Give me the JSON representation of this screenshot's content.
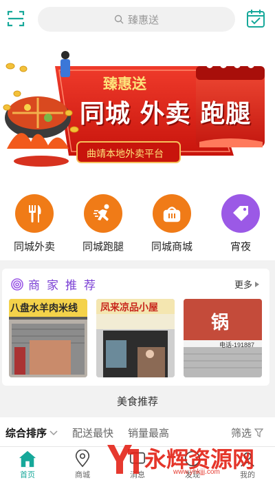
{
  "search": {
    "placeholder": "臻惠送"
  },
  "banner": {
    "brand": "臻惠送",
    "headline": "同城 外卖 跑腿",
    "tagline": "曲靖本地外卖平台"
  },
  "categories": [
    {
      "label": "同城外卖",
      "color": "#f07b17",
      "icon": "fork-knife-icon"
    },
    {
      "label": "同城跑腿",
      "color": "#f07b17",
      "icon": "runner-icon"
    },
    {
      "label": "同城商城",
      "color": "#f07b17",
      "icon": "basket-icon"
    },
    {
      "label": "宵夜",
      "color": "#9b59e6",
      "icon": "tag-icon"
    }
  ],
  "merchants": {
    "title": "商家推荐",
    "more": "更多",
    "shops": [
      {
        "sign": "八盘水羊肉米线"
      },
      {
        "sign": "凤来凉品小屋"
      },
      {
        "sign": "锅",
        "phone": "电话-191887"
      }
    ]
  },
  "food_title": "美食推荐",
  "filters": {
    "sort": "综合排序",
    "fast": "配送最快",
    "sales": "销量最高",
    "filter": "筛选"
  },
  "tabs": [
    {
      "label": "首页"
    },
    {
      "label": "商城"
    },
    {
      "label": "消息"
    },
    {
      "label": "发现"
    },
    {
      "label": "我的"
    }
  ],
  "watermark": {
    "text": "永辉资源网",
    "url": "www.yhkjjj.com"
  },
  "colors": {
    "accent": "#16a89a",
    "orange": "#f07b17",
    "purple": "#9b59e6",
    "banner_red": "#e0231a"
  }
}
